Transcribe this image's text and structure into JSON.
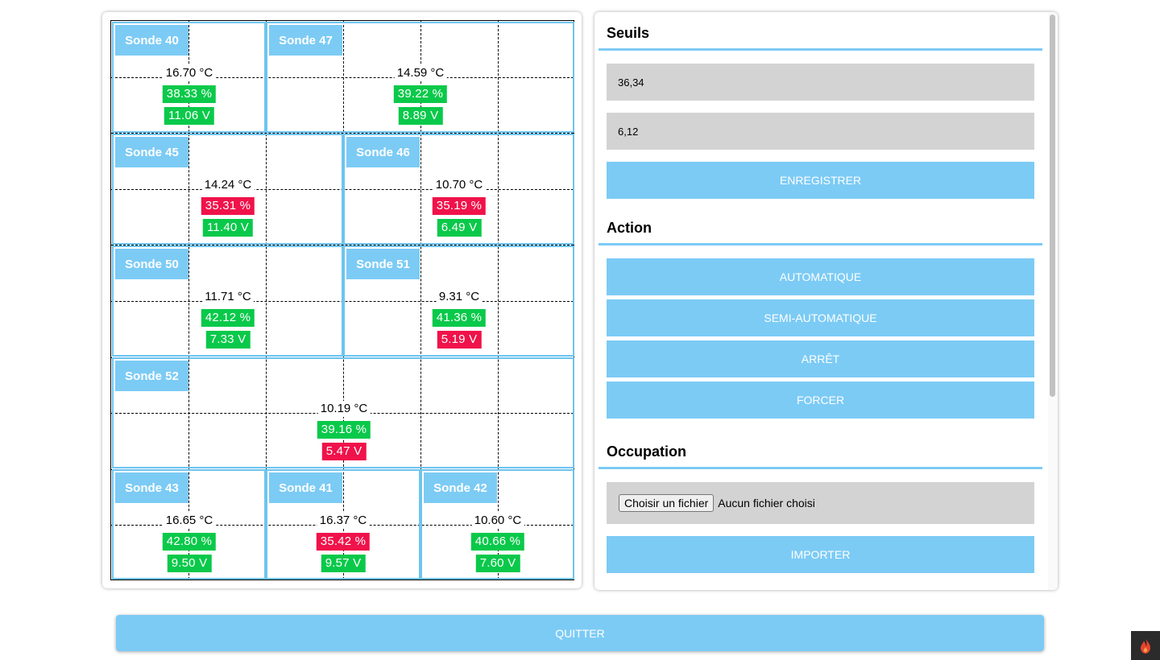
{
  "zones": [
    {
      "label": "Sonde 40",
      "temp": "16.70 °C",
      "humidity": "38.33 %",
      "humidity_status": "ok",
      "voltage": "11.06 V",
      "voltage_status": "ok"
    },
    {
      "label": "Sonde 47",
      "temp": "14.59 °C",
      "humidity": "39.22 %",
      "humidity_status": "ok",
      "voltage": "8.89 V",
      "voltage_status": "ok"
    },
    {
      "label": "Sonde 45",
      "temp": "14.24 °C",
      "humidity": "35.31 %",
      "humidity_status": "bad",
      "voltage": "11.40 V",
      "voltage_status": "ok"
    },
    {
      "label": "Sonde 46",
      "temp": "10.70 °C",
      "humidity": "35.19 %",
      "humidity_status": "bad",
      "voltage": "6.49 V",
      "voltage_status": "ok"
    },
    {
      "label": "Sonde 50",
      "temp": "11.71 °C",
      "humidity": "42.12 %",
      "humidity_status": "ok",
      "voltage": "7.33 V",
      "voltage_status": "ok"
    },
    {
      "label": "Sonde 51",
      "temp": "9.31 °C",
      "humidity": "41.36 %",
      "humidity_status": "ok",
      "voltage": "5.19 V",
      "voltage_status": "bad"
    },
    {
      "label": "Sonde 52",
      "temp": "10.19 °C",
      "humidity": "39.16 %",
      "humidity_status": "ok",
      "voltage": "5.47 V",
      "voltage_status": "bad"
    },
    {
      "label": "Sonde 43",
      "temp": "16.65 °C",
      "humidity": "42.80 %",
      "humidity_status": "ok",
      "voltage": "9.50 V",
      "voltage_status": "ok"
    },
    {
      "label": "Sonde 41",
      "temp": "16.37 °C",
      "humidity": "35.42 %",
      "humidity_status": "bad",
      "voltage": "9.57 V",
      "voltage_status": "ok"
    },
    {
      "label": "Sonde 42",
      "temp": "10.60 °C",
      "humidity": "40.66 %",
      "humidity_status": "ok",
      "voltage": "7.60 V",
      "voltage_status": "ok"
    }
  ],
  "thresholds": {
    "title": "Seuils",
    "field1_value": "36,34",
    "field2_value": "6,12",
    "save_label": "ENREGISTRER"
  },
  "action": {
    "title": "Action",
    "buttons": [
      "AUTOMATIQUE",
      "SEMI-AUTOMATIQUE",
      "ARRÊT",
      "FORCER"
    ]
  },
  "occupation": {
    "title": "Occupation",
    "file_button_label": "Choisir un fichier",
    "file_status": "Aucun fichier choisi",
    "import_label": "IMPORTER"
  },
  "quit_label": "QUITTER",
  "colors": {
    "accent": "#7ccbf5",
    "ok": "#0ac94a",
    "bad": "#f0124a",
    "field_bg": "#d3d3d3"
  },
  "debug_badge_icon": "flame-icon"
}
